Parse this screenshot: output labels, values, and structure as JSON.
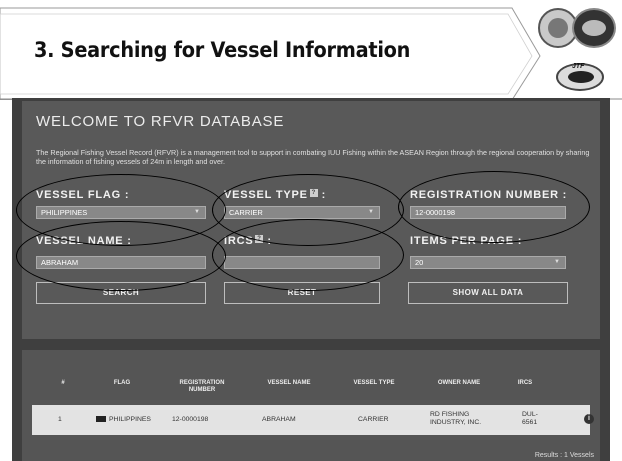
{
  "slide": {
    "title": "3. Searching for Vessel Information"
  },
  "page": {
    "welcome": "WELCOME TO RFVR DATABASE",
    "description": "The Regional Fishing Vessel Record (RFVR) is a management tool to support in combating IUU Fishing within the ASEAN Region through the regional cooperation by sharing the information of fishing vessels of 24m in length and over."
  },
  "form": {
    "vessel_flag": {
      "label": "VESSEL FLAG :",
      "value": "PHILIPPINES"
    },
    "vessel_type": {
      "label": "VESSEL TYPE",
      "suffix": ":",
      "value": "CARRIER"
    },
    "registration_number": {
      "label": "REGISTRATION NUMBER :",
      "value": "12-0000198"
    },
    "vessel_name": {
      "label": "VESSEL NAME :",
      "value": "ABRAHAM"
    },
    "ircs": {
      "label": "IRCS",
      "suffix": ":",
      "value": ""
    },
    "items_per_page": {
      "label": "ITEMS PER PAGE :",
      "value": "20"
    },
    "help_glyph": "?",
    "caret_glyph": "▼",
    "search_label": "SEARCH",
    "reset_label": "RESET",
    "show_all_label": "SHOW ALL DATA"
  },
  "table": {
    "headers": {
      "num": "#",
      "flag": "FLAG",
      "registration_number": "REGISTRATION NUMBER",
      "vessel_name": "VESSEL NAME",
      "vessel_type": "VESSEL TYPE",
      "owner_name": "OWNER NAME",
      "ircs": "IRCS"
    },
    "rows": [
      {
        "num": "1",
        "flag": "PHILIPPINES",
        "registration_number": "12-0000198",
        "vessel_name": "ABRAHAM",
        "vessel_type": "CARRIER",
        "owner_name": "RD FISHING INDUSTRY, INC.",
        "ircs": "DUL-6561",
        "info_glyph": "i"
      }
    ],
    "results": "Results : 1 Vessels"
  },
  "logos": {
    "jtf_text": "JTF"
  }
}
